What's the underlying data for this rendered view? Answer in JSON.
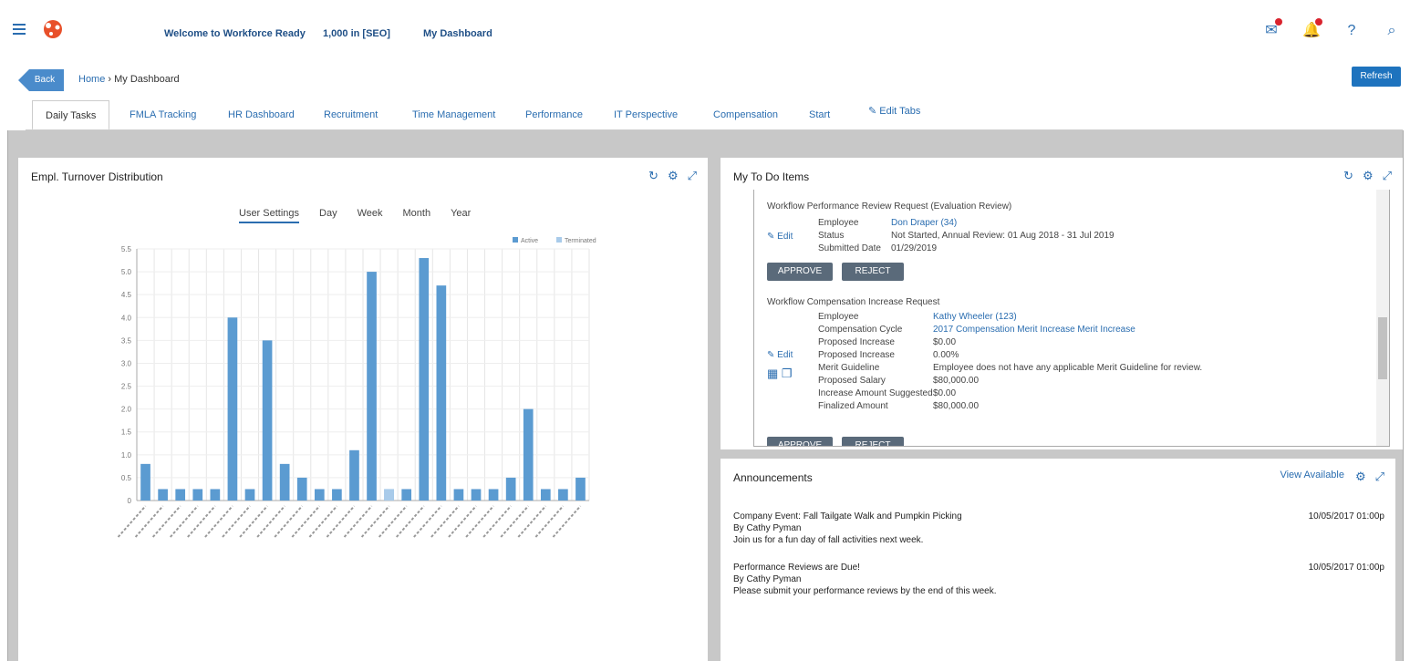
{
  "header": {
    "welcome": "Welcome to Workforce Ready",
    "company": "1,000 in [SEO]",
    "dashboard_link": "My Dashboard"
  },
  "breadcrumb": {
    "back": "Back",
    "home": "Home",
    "current": "My Dashboard"
  },
  "refresh_label": "Refresh",
  "tabs": [
    "Daily Tasks",
    "FMLA Tracking",
    "HR Dashboard",
    "Recruitment",
    "Time Management",
    "Performance",
    "IT Perspective",
    "Compensation",
    "Start"
  ],
  "edit_tabs": "Edit Tabs",
  "turnover": {
    "title": "Empl. Turnover Distribution",
    "range_tabs": [
      "User Settings",
      "Day",
      "Week",
      "Month",
      "Year"
    ],
    "legend": [
      "Active",
      "Terminated"
    ]
  },
  "chart_data": {
    "type": "bar",
    "ylim": [
      0,
      5.5
    ],
    "yticks": [
      "0",
      "0.5",
      "1.0",
      "1.5",
      "2.0",
      "2.5",
      "3.0",
      "3.5",
      "4.0",
      "4.5",
      "5.0",
      "5.5"
    ],
    "series": [
      {
        "name": "Active",
        "values": [
          0.8,
          0.25,
          0.25,
          0.25,
          0.25,
          4.0,
          0.25,
          3.5,
          0.8,
          0.5,
          0.25,
          0.25,
          1.1,
          5.0,
          0.25,
          0.25,
          5.3,
          4.7,
          0.25,
          0.25,
          0.25,
          0.5,
          2.0,
          0.25,
          0.25,
          0.5
        ]
      },
      {
        "name": "Terminated",
        "values": [
          0,
          0,
          0,
          0,
          0,
          0,
          0,
          0,
          0,
          0,
          0,
          0,
          0,
          0,
          0.25,
          0,
          0,
          0,
          0,
          0,
          0,
          0,
          0,
          0,
          0,
          0
        ]
      }
    ]
  },
  "todo": {
    "title": "My To Do Items",
    "item1": {
      "heading": "Workflow Performance Review Request (Evaluation Review)",
      "employee_label": "Employee",
      "employee_value": "Don Draper (34)",
      "status_label": "Status",
      "status_value": "Not Started, Annual Review: 01 Aug 2018 - 31 Jul 2019",
      "submitted_label": "Submitted Date",
      "submitted_value": "01/29/2019",
      "edit": "Edit",
      "approve": "APPROVE",
      "reject": "REJECT"
    },
    "item2": {
      "heading": "Workflow Compensation Increase Request",
      "edit": "Edit",
      "rows": [
        {
          "label": "Employee",
          "value": "Kathy Wheeler (123)"
        },
        {
          "label": "Compensation Cycle",
          "value": "2017 Compensation Merit Increase Merit Increase"
        },
        {
          "label": "Proposed Increase",
          "value": "$0.00"
        },
        {
          "label": "Proposed Increase",
          "value": "0.00%"
        },
        {
          "label": "Merit Guideline",
          "value": "Employee does not have any applicable Merit Guideline for review."
        },
        {
          "label": "Proposed Salary",
          "value": "$80,000.00"
        },
        {
          "label": "Increase Amount Suggested",
          "value": "$0.00"
        },
        {
          "label": "Finalized Amount",
          "value": "$80,000.00"
        }
      ],
      "approve": "APPROVE",
      "reject": "REJECT"
    }
  },
  "announcements": {
    "title": "Announcements",
    "view_available": "View Available",
    "items": [
      {
        "title": "Company Event: Fall Tailgate Walk and Pumpkin Picking",
        "author": "By Cathy Pyman",
        "body": "Join us for a fun day of fall activities next week.",
        "date": "10/05/2017 01:00p"
      },
      {
        "title": "Performance Reviews are Due!",
        "author": "By Cathy Pyman",
        "body": "Please submit your performance reviews by the end of this week.",
        "date": "10/05/2017 01:00p"
      }
    ]
  }
}
